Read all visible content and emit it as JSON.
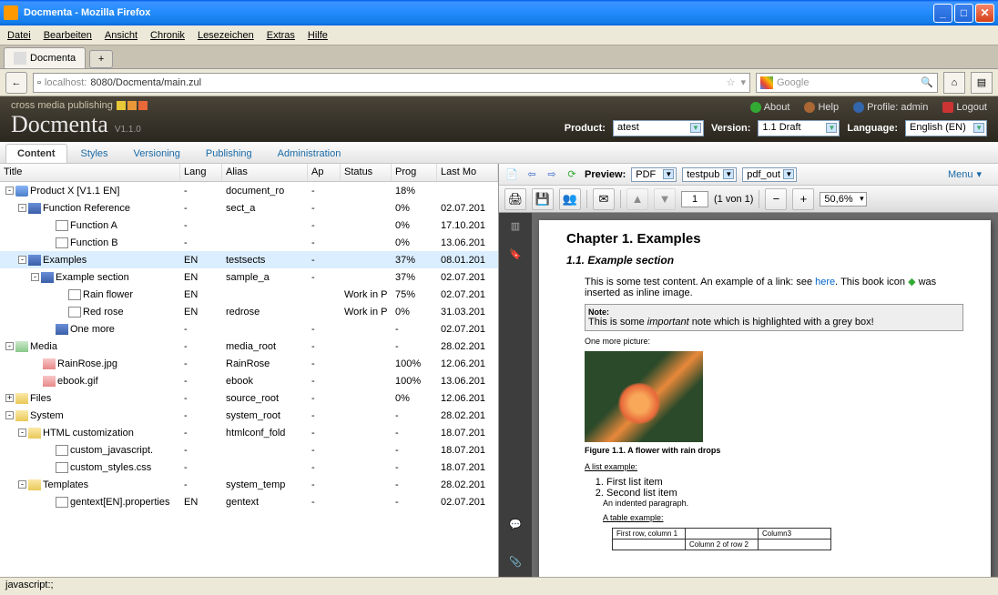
{
  "window": {
    "title": "Docmenta - Mozilla Firefox"
  },
  "ff_menu": [
    "Datei",
    "Bearbeiten",
    "Ansicht",
    "Chronik",
    "Lesezeichen",
    "Extras",
    "Hilfe"
  ],
  "ff_tab": "Docmenta",
  "url": {
    "host": "localhost:",
    "port": "8080",
    "path": "/Docmenta/main.zul"
  },
  "search_placeholder": "Google",
  "brand": {
    "tag": "cross media publishing",
    "name": "Docmenta",
    "version": "V1.1.0"
  },
  "header_links": {
    "about": "About",
    "help": "Help",
    "profile": "Profile: admin",
    "logout": "Logout"
  },
  "header_selects": {
    "product_label": "Product:",
    "product_value": "atest",
    "version_label": "Version:",
    "version_value": "1.1 Draft",
    "language_label": "Language:",
    "language_value": "English (EN)"
  },
  "tabs": {
    "content": "Content",
    "styles": "Styles",
    "versioning": "Versioning",
    "publishing": "Publishing",
    "administration": "Administration"
  },
  "tree_header": {
    "title": "Title",
    "lang": "Lang",
    "alias": "Alias",
    "ap": "Ap",
    "status": "Status",
    "prog": "Prog",
    "last": "Last Mo"
  },
  "tree": [
    {
      "indent": 0,
      "exp": "-",
      "ic": "product",
      "title": "Product X [V1.1 EN]",
      "lang": "-",
      "alias": "document_ro",
      "ap": "-",
      "status": "",
      "prog": "18%",
      "last": ""
    },
    {
      "indent": 1,
      "exp": "-",
      "ic": "book",
      "title": "Function Reference",
      "lang": "-",
      "alias": "sect_a",
      "ap": "-",
      "status": "",
      "prog": "0%",
      "last": "02.07.201"
    },
    {
      "indent": 3,
      "exp": "",
      "ic": "page",
      "title": "Function A",
      "lang": "-",
      "alias": "",
      "ap": "-",
      "status": "",
      "prog": "0%",
      "last": "17.10.201"
    },
    {
      "indent": 3,
      "exp": "",
      "ic": "page",
      "title": "Function B",
      "lang": "-",
      "alias": "",
      "ap": "-",
      "status": "",
      "prog": "0%",
      "last": "13.06.201"
    },
    {
      "indent": 1,
      "exp": "-",
      "ic": "book",
      "title": "Examples",
      "lang": "EN",
      "alias": "testsects",
      "ap": "-",
      "status": "",
      "prog": "37%",
      "last": "08.01.201",
      "sel": true
    },
    {
      "indent": 2,
      "exp": "-",
      "ic": "book",
      "title": "Example section",
      "lang": "EN",
      "alias": "sample_a",
      "ap": "-",
      "status": "",
      "prog": "37%",
      "last": "02.07.201"
    },
    {
      "indent": 4,
      "exp": "",
      "ic": "page",
      "title": "Rain flower",
      "lang": "EN",
      "alias": "",
      "ap": "",
      "status": "Work in P",
      "prog": "75%",
      "last": "02.07.201"
    },
    {
      "indent": 4,
      "exp": "",
      "ic": "page",
      "title": "Red rose",
      "lang": "EN",
      "alias": "redrose",
      "ap": "",
      "status": "Work in P",
      "prog": "0%",
      "last": "31.03.201"
    },
    {
      "indent": 3,
      "exp": "",
      "ic": "book",
      "title": "One more",
      "lang": "-",
      "alias": "",
      "ap": "-",
      "status": "",
      "prog": "-",
      "last": "02.07.201"
    },
    {
      "indent": 0,
      "exp": "-",
      "ic": "media",
      "title": "Media",
      "lang": "-",
      "alias": "media_root",
      "ap": "-",
      "status": "",
      "prog": "-",
      "last": "28.02.201"
    },
    {
      "indent": 2,
      "exp": "",
      "ic": "img",
      "title": "RainRose.jpg",
      "lang": "-",
      "alias": "RainRose",
      "ap": "-",
      "status": "",
      "prog": "100%",
      "last": "12.06.201"
    },
    {
      "indent": 2,
      "exp": "",
      "ic": "img",
      "title": "ebook.gif",
      "lang": "-",
      "alias": "ebook",
      "ap": "-",
      "status": "",
      "prog": "100%",
      "last": "13.06.201"
    },
    {
      "indent": 0,
      "exp": "+",
      "ic": "folder",
      "title": "Files",
      "lang": "-",
      "alias": "source_root",
      "ap": "-",
      "status": "",
      "prog": "0%",
      "last": "12.06.201"
    },
    {
      "indent": 0,
      "exp": "-",
      "ic": "folder",
      "title": "System",
      "lang": "-",
      "alias": "system_root",
      "ap": "-",
      "status": "",
      "prog": "-",
      "last": "28.02.201"
    },
    {
      "indent": 1,
      "exp": "-",
      "ic": "folder",
      "title": "HTML customization",
      "lang": "-",
      "alias": "htmlconf_fold",
      "ap": "-",
      "status": "",
      "prog": "-",
      "last": "18.07.201"
    },
    {
      "indent": 3,
      "exp": "",
      "ic": "page",
      "title": "custom_javascript.",
      "lang": "-",
      "alias": "",
      "ap": "-",
      "status": "",
      "prog": "-",
      "last": "18.07.201"
    },
    {
      "indent": 3,
      "exp": "",
      "ic": "page",
      "title": "custom_styles.css",
      "lang": "-",
      "alias": "",
      "ap": "-",
      "status": "",
      "prog": "-",
      "last": "18.07.201"
    },
    {
      "indent": 1,
      "exp": "-",
      "ic": "folder",
      "title": "Templates",
      "lang": "-",
      "alias": "system_temp",
      "ap": "-",
      "status": "",
      "prog": "-",
      "last": "28.02.201"
    },
    {
      "indent": 3,
      "exp": "",
      "ic": "page",
      "title": "gentext[EN].properties",
      "lang": "EN",
      "alias": "gentext",
      "ap": "-",
      "status": "",
      "prog": "-",
      "last": "02.07.201"
    }
  ],
  "preview_bar": {
    "label": "Preview:",
    "format": "PDF",
    "pub": "testpub",
    "out": "pdf_out",
    "menu": "Menu"
  },
  "pdf_toolbar": {
    "page": "1",
    "of": "(1 von 1)",
    "zoom": "50,6%"
  },
  "doc": {
    "h1": "Chapter 1. Examples",
    "h2": "1.1. Example section",
    "p1a": "This is some test content. An example of a link: see ",
    "p1link": "here",
    "p1b": ". This book icon ",
    "p1c": " was inserted as inline image.",
    "note_label": "Note:",
    "note_text": "This is some important note which is highlighted with a grey box!",
    "p2": "One more picture:",
    "caption": "Figure 1.1. A flower with rain drops",
    "listhead": "A list example:",
    "li1": "First list item",
    "li2": "Second list item",
    "indented": "An indented paragraph.",
    "tablehead": "A table example:",
    "t_r1c1": "First row, column 1",
    "t_r1c2": "",
    "t_r1c3": "Column3",
    "t_r2c1": "",
    "t_r2c2": "Column 2 of row 2",
    "t_r2c3": ""
  },
  "status": "javascript:;"
}
